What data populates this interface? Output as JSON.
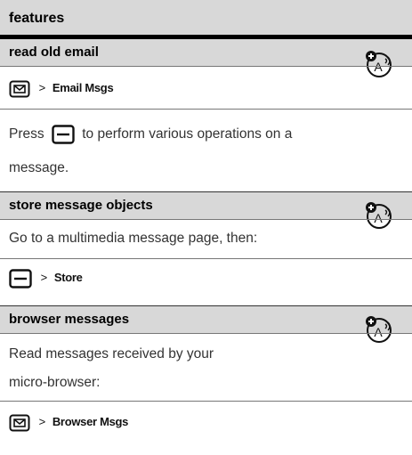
{
  "header": {
    "title": "features"
  },
  "sections": [
    {
      "title": "read old email",
      "nav": {
        "arrow": ">",
        "label": "Email Msgs"
      },
      "text_line1_a": "Press",
      "text_line1_b": "to perform various operations on a",
      "text_line2": "message."
    },
    {
      "title": "store message objects",
      "text_line1": "Go to a multimedia message page, then:",
      "nav": {
        "arrow": ">",
        "label": "Store"
      }
    },
    {
      "title": "browser messages",
      "text_line1": "Read messages received by your",
      "text_line2": "micro-browser:",
      "nav": {
        "arrow": ">",
        "label": "Browser Msgs"
      }
    }
  ],
  "icons": {
    "network": "network-dependent-feature-icon",
    "message_key": "message-key-icon",
    "menu_key": "menu-key-icon"
  }
}
